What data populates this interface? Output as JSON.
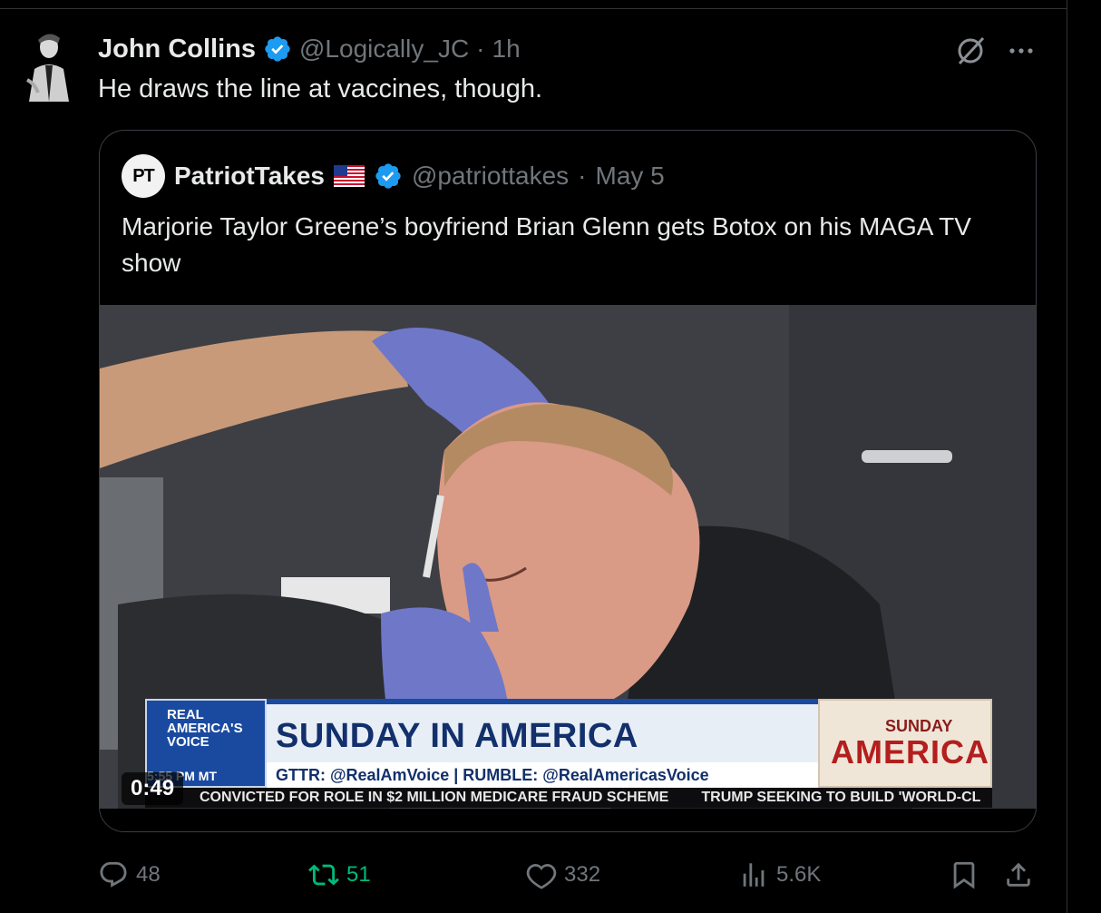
{
  "tweet": {
    "display_name": "John Collins",
    "handle": "@Logically_JC",
    "separator": "·",
    "time": "1h",
    "text": "He draws the line at vaccines, though.",
    "verified_badge": "blue-check"
  },
  "quote": {
    "avatar_text": "PT",
    "display_name": "PatriotTakes",
    "flag": "us-flag",
    "handle": "@patriottakes",
    "separator": "·",
    "time": "May 5",
    "text": "Marjorie Taylor Greene’s boyfriend Brian Glenn gets Botox on his MAGA TV show",
    "video": {
      "duration": "0:49",
      "chyron_brand_lines": [
        "REAL",
        "AMERICA'S",
        "VOICE"
      ],
      "chyron_time": "5:55 PM MT",
      "show_title": "SUNDAY IN AMERICA",
      "social_line": "GTTR: @RealAmVoice | RUMBLE: @RealAmericasVoice",
      "logo_top": "SUNDAY",
      "logo_main": "AMERICA",
      "ticker_left": "CONVICTED FOR ROLE IN $2 MILLION MEDICARE FRAUD SCHEME",
      "ticker_right": "TRUMP SEEKING TO BUILD 'WORLD-CL"
    }
  },
  "actions": {
    "replies": "48",
    "reposts": "51",
    "likes": "332",
    "views": "5.6K"
  },
  "colors": {
    "background": "#000000",
    "text": "#e7e9ea",
    "muted": "#71767b",
    "verified": "#1d9bf0",
    "repost_active": "#00ba7c",
    "border": "#2f3336"
  }
}
